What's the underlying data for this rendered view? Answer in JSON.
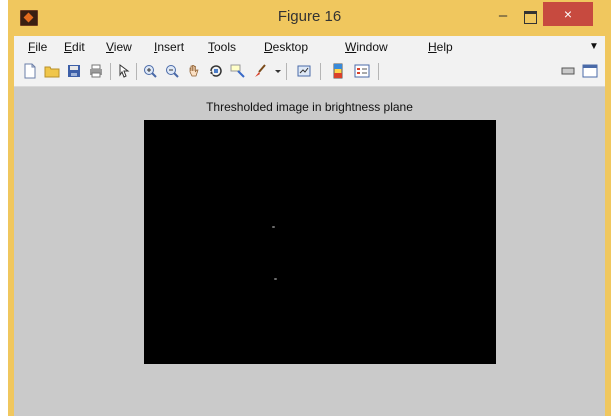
{
  "window": {
    "title": "Figure 16",
    "minimize_label": "–",
    "close_label": "×"
  },
  "menubar": {
    "items": [
      {
        "underline": "F",
        "rest": "ile"
      },
      {
        "underline": "E",
        "rest": "dit"
      },
      {
        "underline": "V",
        "rest": "iew"
      },
      {
        "underline": "I",
        "rest": "nsert"
      },
      {
        "underline": "T",
        "rest": "ools"
      },
      {
        "underline": "D",
        "rest": "esktop"
      },
      {
        "underline": "W",
        "rest": "indow"
      },
      {
        "underline": "H",
        "rest": "elp"
      }
    ],
    "overflow_icon": "chevron-icon"
  },
  "toolbar": {
    "icons": [
      "new-figure-icon",
      "open-file-icon",
      "save-icon",
      "print-icon",
      "edit-plot-arrow-icon",
      "zoom-in-icon",
      "zoom-out-icon",
      "pan-hand-icon",
      "rotate-3d-icon",
      "data-cursor-icon",
      "brush-icon",
      "dropdown-arrow-icon",
      "link-plot-icon",
      "colorbar-icon",
      "legend-icon",
      "hide-plot-tools-icon",
      "show-plot-tools-icon"
    ]
  },
  "figure": {
    "axes_title": "Thresholded image in brightness plane",
    "image_background": "#000000"
  },
  "colors": {
    "titlebar": "#f0c75e",
    "close_button": "#c74a3f",
    "figure_background": "#cacaca"
  }
}
